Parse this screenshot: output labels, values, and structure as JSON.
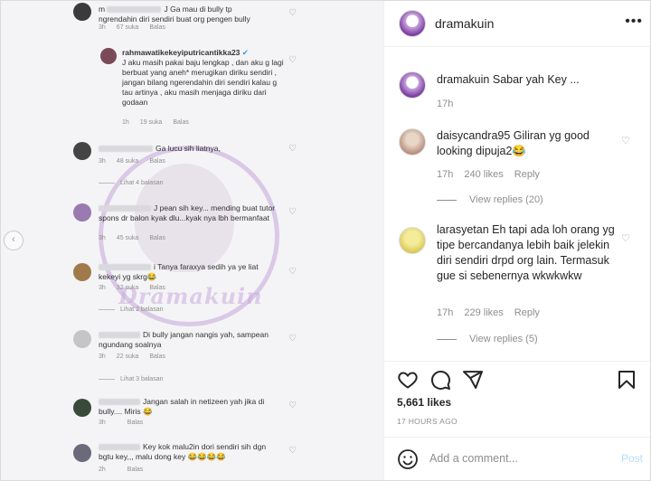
{
  "left": {
    "comments": [
      {
        "text": "J Ga mau di bully tp ngrendahin diri sendiri buat org pengen bully",
        "prefix": "m",
        "time": "3h",
        "likes": "67 suka",
        "reply": "Balas"
      },
      {
        "user": "rahmawatikekeyiputricantikka23",
        "text": "J aku masih pakai baju lengkap , dan aku g lagi berbuat yang aneh* merugikan diriku sendiri , jangan bilang ngerendahin diri sendiri kalau g tau artinya , aku masih menjaga diriku dari godaan",
        "time": "1h",
        "likes": "19 suka",
        "reply": "Balas"
      },
      {
        "text": "Ga lucu sih liatnya,",
        "time": "3h",
        "likes": "48 suka",
        "reply": "Balas",
        "view": "Lihat 4 balasan"
      },
      {
        "text": "J pean sih key... mending buat tutor spons dr balon kyak dlu...kyak nya lbh bermanfaat",
        "time": "3h",
        "likes": "45 suka",
        "reply": "Balas"
      },
      {
        "text": "i Tanya faraxya sedih ya ye liat kekeyi yg skrg😂",
        "time": "3h",
        "likes": "32 suka",
        "reply": "Balas",
        "view": "Lihat 2 balasan"
      },
      {
        "text": "Di bully jangan nangis yah, sampean ngundang soalnya",
        "time": "3h",
        "likes": "22 suka",
        "reply": "Balas",
        "view": "Lihat 3 balasan"
      },
      {
        "text": "Jangan salah in netizeen yah jika di bully.... Miris 😂",
        "time": "3h",
        "likes": "",
        "reply": "Balas"
      },
      {
        "text": "Key kok malu2in dori sendiri sih dgn bgtu key,,, malu dong key 😂😂😂😂",
        "time": "2h",
        "likes": "",
        "reply": "Balas"
      }
    ],
    "watermark": "Dramakuin"
  },
  "right": {
    "header": {
      "username": "dramakuin"
    },
    "caption": {
      "username": "dramakuin",
      "text": "Sabar yah Key ...",
      "time": "17h"
    },
    "comments": [
      {
        "username": "daisycandra95",
        "text": "Giliran yg good looking dipuja2😂",
        "time": "17h",
        "likes": "240 likes",
        "reply": "Reply",
        "view": "View replies (20)"
      },
      {
        "username": "larasyetan",
        "text": "Eh tapi ada loh orang yg tipe bercandanya lebih baik jelekin diri sendiri drpd org lain. Termasuk gue si sebenernya wkwkwkw",
        "time": "17h",
        "likes": "229 likes",
        "reply": "Reply",
        "view": "View replies (5)"
      }
    ],
    "likes_count": "5,661 likes",
    "posted": "17 HOURS AGO",
    "add_comment": "Add a comment...",
    "post_label": "Post"
  }
}
